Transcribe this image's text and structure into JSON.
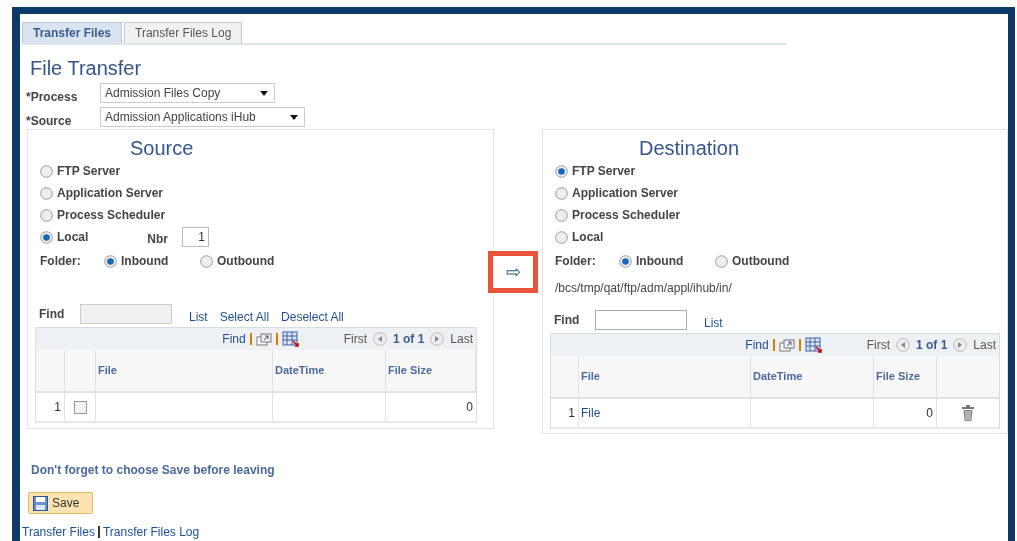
{
  "tabs": [
    {
      "label": "Transfer Files",
      "selected": true
    },
    {
      "label": "Transfer Files Log",
      "selected": false
    }
  ],
  "title": "File Transfer",
  "fields": [
    {
      "label": "*Process",
      "value": "Admission Files Copy"
    },
    {
      "label": "*Source",
      "value": "Admission Applications iHub"
    }
  ],
  "panels": [
    {
      "title": "Source",
      "options": [
        {
          "label": "FTP Server",
          "selected": false
        },
        {
          "label": "Application Server",
          "selected": false
        },
        {
          "label": "Process Scheduler",
          "selected": false
        },
        {
          "label": "Local",
          "selected": true
        }
      ],
      "nbr": {
        "label": "Nbr",
        "value": "1"
      },
      "folder": {
        "label": "Folder:",
        "options": [
          {
            "label": "Inbound",
            "selected": true
          },
          {
            "label": "Outbound",
            "selected": false
          }
        ]
      },
      "find": {
        "label": "Find",
        "links": [
          "List",
          "Select All",
          "Deselect All"
        ]
      },
      "grid": {
        "toolbar": {
          "find": "Find",
          "first": "First",
          "pager": "1 of 1",
          "last": "Last"
        },
        "columns": [
          "File",
          "DateTime",
          "File Size"
        ],
        "rows": [
          {
            "num": "1",
            "checked": false,
            "size": "0"
          }
        ]
      }
    },
    {
      "title": "Destination",
      "options": [
        {
          "label": "FTP Server",
          "selected": true
        },
        {
          "label": "Application Server",
          "selected": false
        },
        {
          "label": "Process Scheduler",
          "selected": false
        },
        {
          "label": "Local",
          "selected": false
        }
      ],
      "folder": {
        "label": "Folder:",
        "options": [
          {
            "label": "Inbound",
            "selected": true
          },
          {
            "label": "Outbound",
            "selected": false
          }
        ]
      },
      "path": "/bcs/tmp/qat/ftp/adm/appl/ihub/in/",
      "find": {
        "label": "Find",
        "links": [
          "List"
        ]
      },
      "grid": {
        "toolbar": {
          "find": "Find",
          "first": "First",
          "pager": "1 of 1",
          "last": "Last"
        },
        "columns": [
          "File",
          "DateTime",
          "File Size"
        ],
        "rows": [
          {
            "num": "1",
            "file": "File",
            "size": "0",
            "deletable": true
          }
        ]
      }
    }
  ],
  "transfer_button": "⇨",
  "message": "Don't forget to choose Save before leaving",
  "save_button": "Save",
  "footer_links": [
    "Transfer Files",
    "Transfer Files Log"
  ]
}
